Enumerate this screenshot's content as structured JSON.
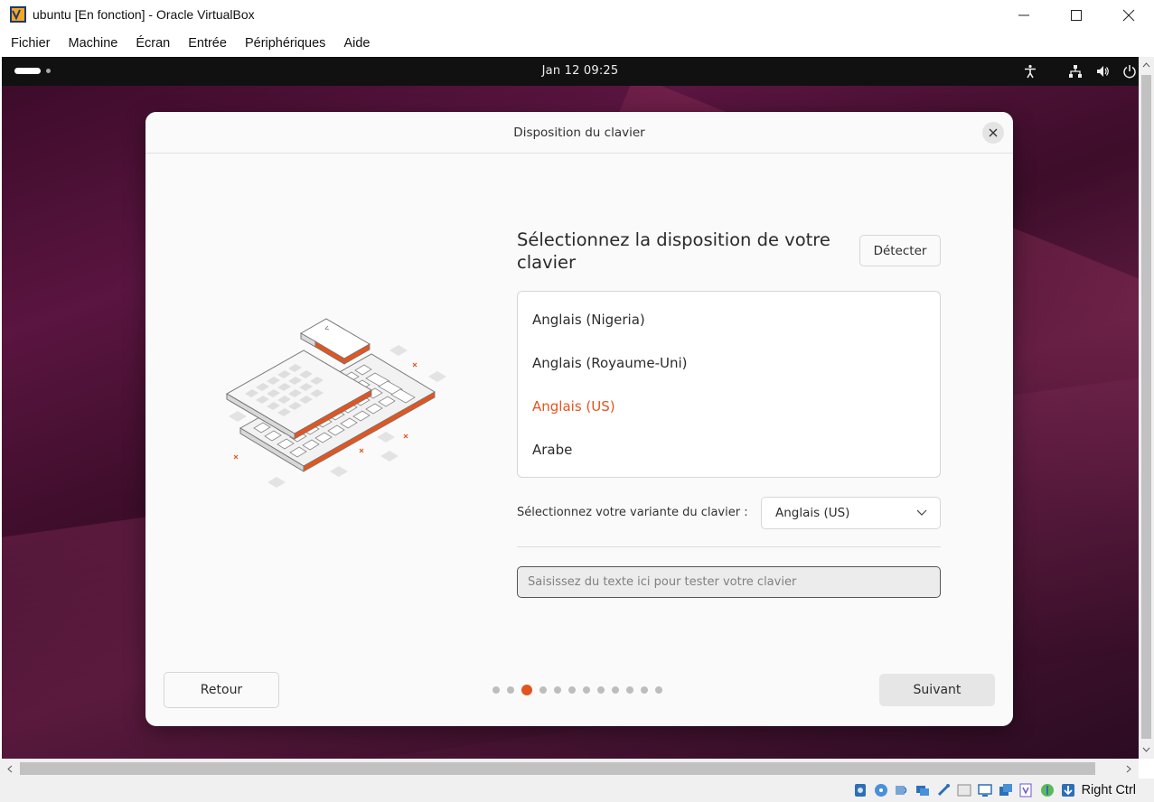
{
  "window": {
    "title": "ubuntu [En fonction] - Oracle VirtualBox",
    "app_icon": "virtualbox-icon"
  },
  "menubar": {
    "items": [
      "Fichier",
      "Machine",
      "Écran",
      "Entrée",
      "Périphériques",
      "Aide"
    ]
  },
  "gnome_topbar": {
    "clock": "Jan 12  09:25",
    "tray_icons": [
      "accessibility-icon",
      "network-icon",
      "volume-icon",
      "power-icon"
    ]
  },
  "dialog": {
    "title": "Disposition du clavier",
    "heading": "Sélectionnez la disposition de votre clavier",
    "detect_label": "Détecter",
    "layouts": [
      {
        "label": "Anglais (Nigeria)",
        "selected": false
      },
      {
        "label": "Anglais (Royaume-Uni)",
        "selected": false
      },
      {
        "label": "Anglais (US)",
        "selected": true
      },
      {
        "label": "Arabe",
        "selected": false
      }
    ],
    "variant_label": "Sélectionnez votre variante du clavier :",
    "variant_value": "Anglais (US)",
    "test_placeholder": "Saisissez du texte ici pour tester votre clavier",
    "test_value": "",
    "back_label": "Retour",
    "next_label": "Suivant",
    "pager": {
      "total": 12,
      "current": 3
    }
  },
  "statusbar": {
    "host_key": "Right Ctrl",
    "icons": [
      "hard-disk-icon",
      "optical-drive-icon",
      "audio-icon",
      "network-adapter-icon",
      "usb-icon",
      "shared-folder-icon",
      "display-icon",
      "video-capture-icon",
      "virtualization-icon",
      "mouse-integration-icon",
      "keyboard-capture-icon"
    ]
  },
  "colors": {
    "accent": "#e2551f",
    "title_bar": "#ffffff",
    "gnome_bar": "#111111"
  }
}
